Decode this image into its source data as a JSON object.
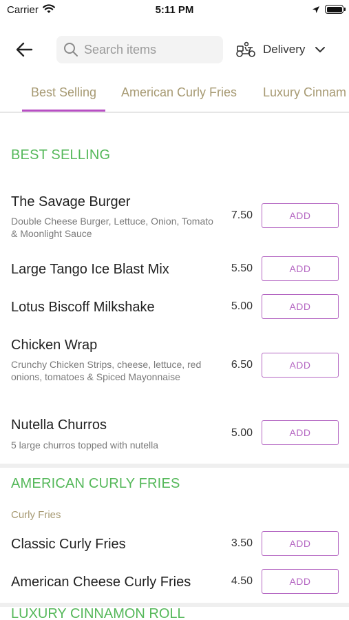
{
  "status": {
    "carrier": "Carrier",
    "time": "5:11 PM"
  },
  "header": {
    "search_placeholder": "Search items",
    "delivery_label": "Delivery"
  },
  "tabs": [
    {
      "label": "Best Selling",
      "active": true
    },
    {
      "label": "American Curly Fries",
      "active": false
    },
    {
      "label": "Luxury Cinnam",
      "active": false
    }
  ],
  "colors": {
    "accent_purple": "#b466c2",
    "section_green": "#55b85a",
    "tab_gold": "#a79a73"
  },
  "sections": [
    {
      "title": "BEST SELLING",
      "items": [
        {
          "name": "The Savage Burger",
          "desc": "Double Cheese Burger, Lettuce, Onion, Tomato & Moonlight Sauce",
          "price": "7.50",
          "add_label": "ADD"
        },
        {
          "name": "Large Tango Ice Blast Mix",
          "desc": "",
          "price": "5.50",
          "add_label": "ADD"
        },
        {
          "name": "Lotus Biscoff Milkshake",
          "desc": "",
          "price": "5.00",
          "add_label": "ADD"
        },
        {
          "name": "Chicken Wrap",
          "desc": "Crunchy Chicken Strips, cheese, lettuce, red onions, tomatoes & Spiced Mayonnaise",
          "price": "6.50",
          "add_label": "ADD"
        },
        {
          "name": "Nutella Churros",
          "desc": "5 large churros topped with nutella",
          "price": "5.00",
          "add_label": "ADD"
        }
      ]
    },
    {
      "title": "AMERICAN CURLY FRIES",
      "subtitle": "Curly Fries",
      "items": [
        {
          "name": "Classic Curly Fries",
          "price": "3.50",
          "add_label": "ADD"
        },
        {
          "name": "American Cheese Curly Fries",
          "price": "4.50",
          "add_label": "ADD"
        }
      ]
    },
    {
      "title": "LUXURY CINNAMON ROLL"
    }
  ]
}
